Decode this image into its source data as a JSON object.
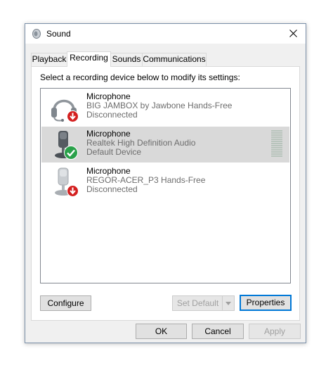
{
  "window": {
    "title": "Sound",
    "icon": "speaker-icon"
  },
  "tabs": [
    {
      "label": "Playback",
      "active": false
    },
    {
      "label": "Recording",
      "active": true
    },
    {
      "label": "Sounds",
      "active": false
    },
    {
      "label": "Communications",
      "active": false
    }
  ],
  "panel": {
    "instruction": "Select a recording device below to modify its settings:"
  },
  "devices": [
    {
      "name": "Microphone",
      "description": "BIG JAMBOX by Jawbone Hands-Free",
      "status": "Disconnected",
      "icon": "headset-icon",
      "badge": "disconnected-arrow-icon",
      "selected": false
    },
    {
      "name": "Microphone",
      "description": "Realtek High Definition Audio",
      "status": "Default Device",
      "icon": "microphone-icon",
      "badge": "default-check-icon",
      "selected": true
    },
    {
      "name": "Microphone",
      "description": "REGOR-ACER_P3 Hands-Free",
      "status": "Disconnected",
      "icon": "microphone-icon",
      "badge": "disconnected-arrow-icon",
      "selected": false
    }
  ],
  "panel_buttons": {
    "configure": "Configure",
    "set_default": "Set Default",
    "properties": "Properties"
  },
  "dialog_buttons": {
    "ok": "OK",
    "cancel": "Cancel",
    "apply": "Apply"
  },
  "colors": {
    "accent": "#0078d7",
    "selection": "#d9d9d9",
    "disconnected_badge": "#d42020",
    "default_badge": "#2aa14a"
  }
}
